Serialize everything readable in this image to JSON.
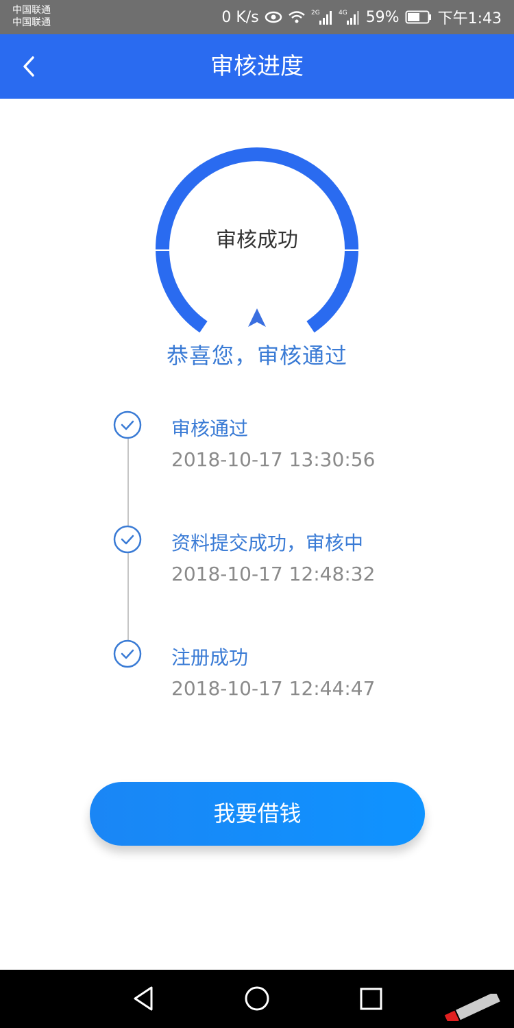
{
  "status_bar": {
    "carrier_1": "中国联通",
    "carrier_2": "中国联通",
    "net_speed": "0 K/s",
    "battery": "59%",
    "time": "下午1:43"
  },
  "header": {
    "title": "审核进度"
  },
  "gauge": {
    "status": "审核成功",
    "color": "#2a6bf0"
  },
  "congrats": "恭喜您，审核通过",
  "timeline": [
    {
      "title": "审核通过",
      "time": "2018-10-17 13:30:56"
    },
    {
      "title": "资料提交成功，审核中",
      "time": "2018-10-17 12:48:32"
    },
    {
      "title": "注册成功",
      "time": "2018-10-17 12:44:47"
    }
  ],
  "actions": {
    "borrow_label": "我要借钱"
  },
  "nav": {
    "back": "back-triangle-icon",
    "home": "home-circle-icon",
    "recents": "recents-square-icon"
  }
}
